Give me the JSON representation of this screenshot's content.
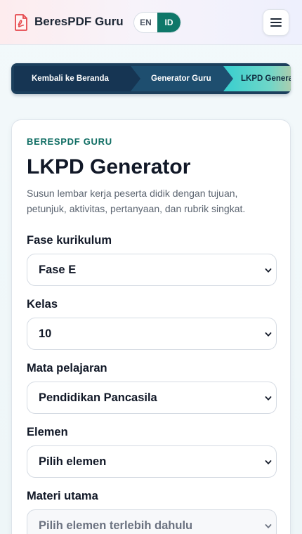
{
  "header": {
    "brand": "BeresPDF Guru",
    "lang_en": "EN",
    "lang_id": "ID",
    "active_lang": "ID"
  },
  "breadcrumb": {
    "items": [
      {
        "label": "Kembali ke Beranda"
      },
      {
        "label": "Generator Guru"
      },
      {
        "label": "LKPD Generator"
      }
    ]
  },
  "form": {
    "eyebrow": "BERESPDF GURU",
    "title": "LKPD Generator",
    "subtitle": "Susun lembar kerja peserta didik dengan tujuan, petunjuk, aktivitas, pertanyaan, dan rubrik singkat.",
    "fields": [
      {
        "label": "Fase kurikulum",
        "value": "Fase E"
      },
      {
        "label": "Kelas",
        "value": "10"
      },
      {
        "label": "Mata pelajaran",
        "value": "Pendidikan Pancasila"
      },
      {
        "label": "Elemen",
        "value": "Pilih elemen"
      },
      {
        "label": "Materi utama",
        "value": "Pilih elemen terlebih dahulu",
        "disabled": true
      }
    ]
  },
  "colors": {
    "accent": "#0f7769",
    "eyebrow": "#0f6d63",
    "breadcrumb_bg": "#1c3f5c",
    "logo_red": "#e5484d"
  },
  "icons": {
    "logo": "pdf-document-icon",
    "menu": "hamburger-menu-icon",
    "select": "chevron-down-icon"
  }
}
